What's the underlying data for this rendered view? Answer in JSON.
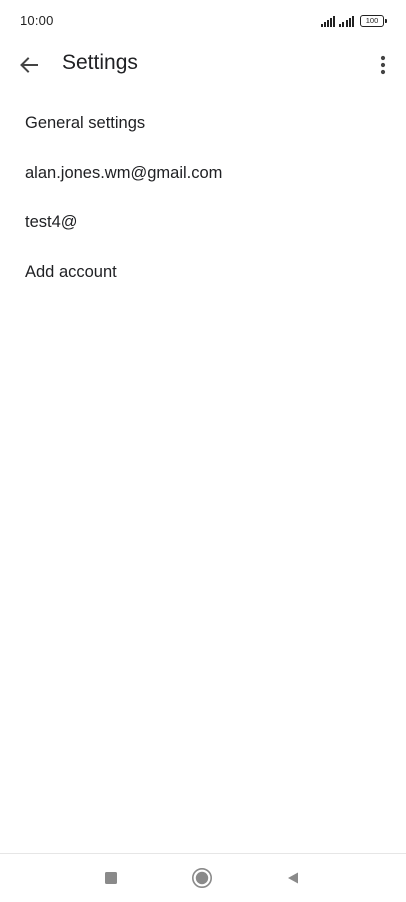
{
  "status_bar": {
    "time": "10:00",
    "battery": "100",
    "icons": [
      "signal-icon",
      "signal-icon",
      "battery-icon"
    ]
  },
  "app_bar": {
    "title": "Settings",
    "back_icon": "arrow-back-icon",
    "overflow_icon": "more-vert-icon"
  },
  "settings": {
    "items": [
      {
        "label": "General settings"
      },
      {
        "label": "alan.jones.wm@gmail.com"
      },
      {
        "label": "test4@"
      },
      {
        "label": "Add account"
      }
    ]
  },
  "nav_bar": {
    "icons": [
      "recents-icon",
      "home-icon",
      "back-icon"
    ]
  },
  "colors": {
    "text": "#202124",
    "icon": "#5f6368",
    "nav_icon": "#8a8a8a",
    "background": "#ffffff"
  }
}
